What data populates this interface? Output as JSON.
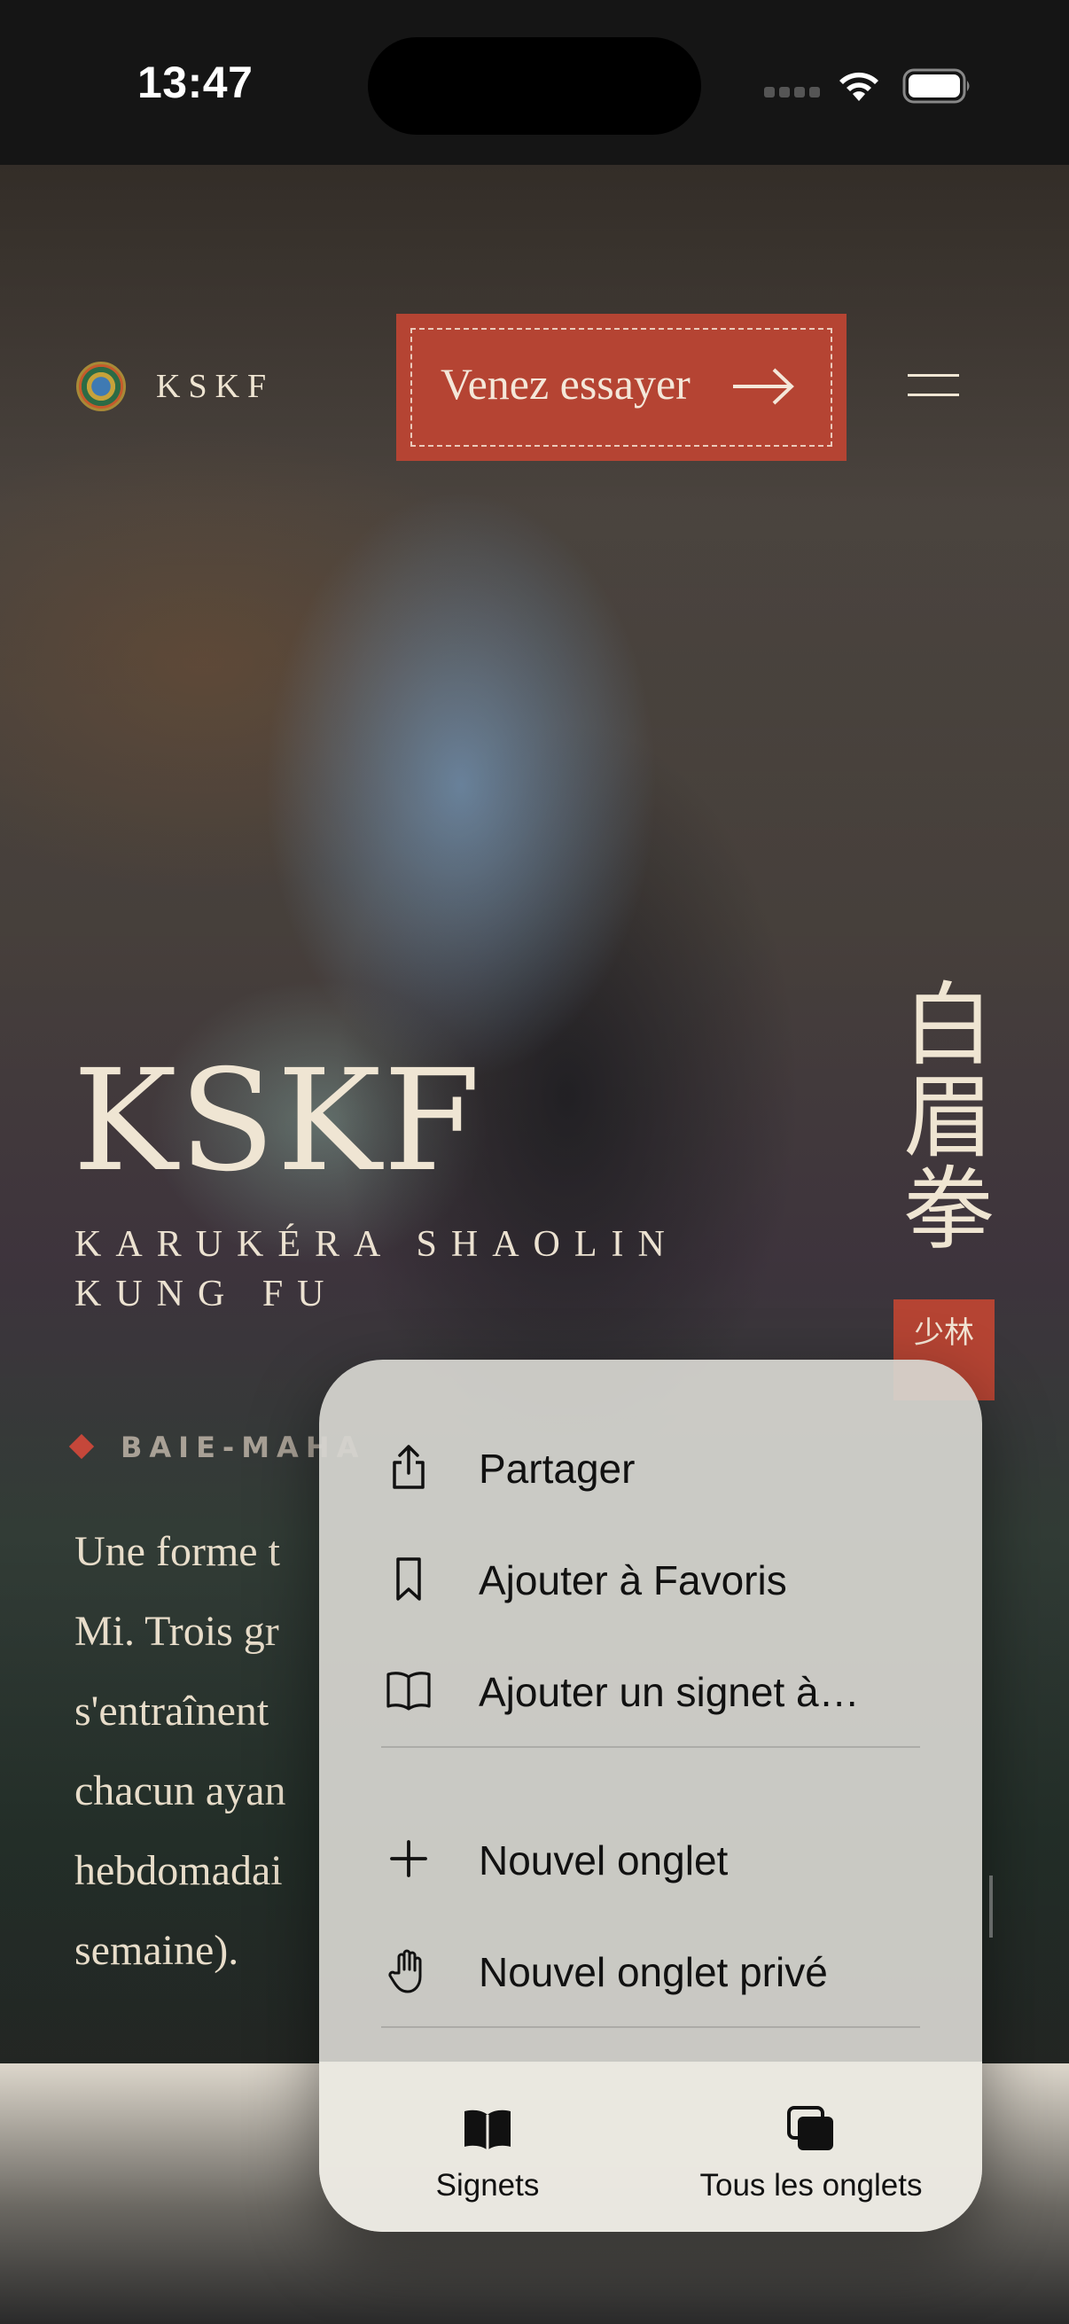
{
  "status": {
    "time": "13:47"
  },
  "site": {
    "brand": "KSKF",
    "cta_label": "Venez essayer",
    "hero_title": "KSKF",
    "hero_subtitle": "KARUKÉRA SHAOLIN KUNG FU",
    "cjk_title": "白眉拳",
    "seal_text": "少林",
    "location": "BAIE-MAHA",
    "description": "Une forme t\nMi. Trois gr\ns'entraînent\nchacun ayan\nhebdomadai\nsemaine)."
  },
  "menu": {
    "items": [
      {
        "label": "Partager",
        "icon": "share-icon"
      },
      {
        "label": "Ajouter à Favoris",
        "icon": "bookmark-icon"
      },
      {
        "label": "Ajouter un signet à…",
        "icon": "book-icon"
      },
      {
        "label": "Nouvel onglet",
        "icon": "plus-icon"
      },
      {
        "label": "Nouvel onglet privé",
        "icon": "hand-icon"
      }
    ],
    "bottom": [
      {
        "label": "Signets",
        "icon": "bookmarks-book-icon"
      },
      {
        "label": "Tous les onglets",
        "icon": "tabs-icon"
      }
    ]
  },
  "colors": {
    "accent_red": "#b54433",
    "cream": "#efe5d2",
    "menu_bg": "#d6d5d0"
  }
}
